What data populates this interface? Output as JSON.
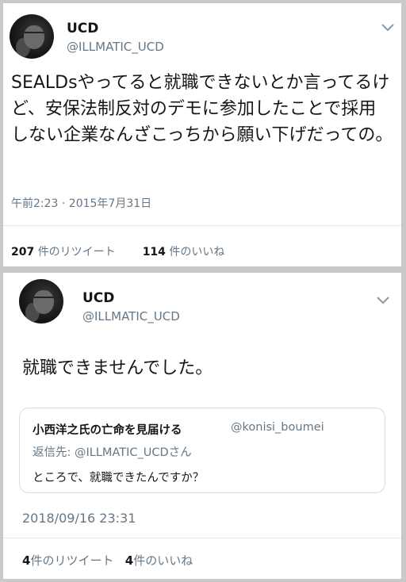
{
  "tweet1": {
    "name": "UCD",
    "handle": "@ILLMATIC_UCD",
    "text": "SEALDsやってると就職できないとか言ってるけど、安保法制反対のデモに参加したことで採用しない企業なんざこっちから願い下げだっての。",
    "timestamp": "午前2:23 · 2015年7月31日",
    "retweet_count": "207",
    "retweet_label": "件のリツイート",
    "like_count": "114",
    "like_label": "件のいいね",
    "menu_icon": "chevron-down-icon"
  },
  "tweet2": {
    "name": "UCD",
    "handle": "@ILLMATIC_UCD",
    "text": "就職できませんでした。",
    "quote": {
      "name": "小西洋之氏の亡命を見届ける",
      "handle": "@konisi_boumei",
      "reply_prefix": "返信先: @ILLMATIC_UCDさん",
      "text": "ところで、就職できたんですか？"
    },
    "timestamp": "2018/09/16 23:31",
    "retweet_count": "4",
    "retweet_label": "件のリツイート",
    "like_count": "4",
    "like_label": "件のいいね",
    "menu_icon": "chevron-down-icon"
  },
  "colors": {
    "text": "#14171a",
    "secondary": "#657786",
    "border": "#e1e8ed",
    "frame": "#c9c9c9"
  }
}
